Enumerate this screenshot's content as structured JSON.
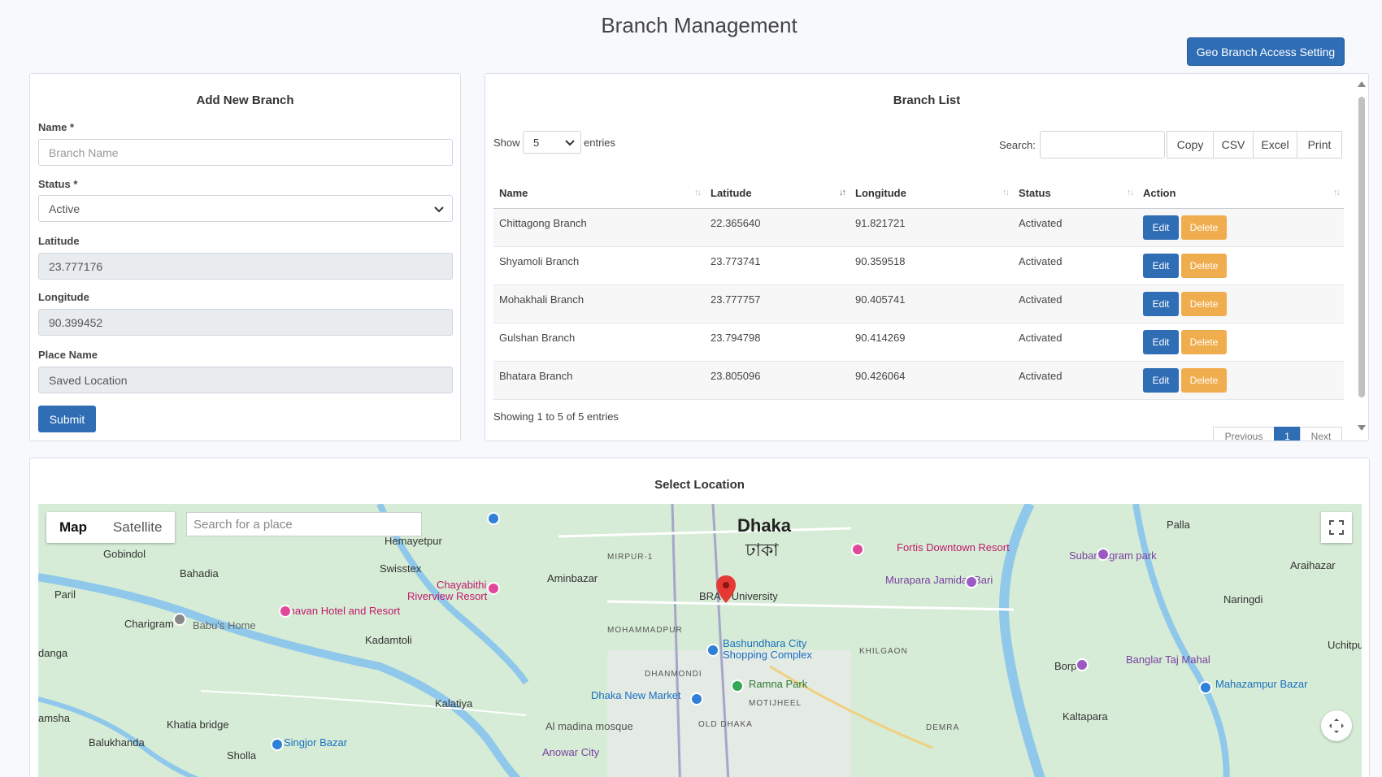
{
  "page_title": "Branch Management",
  "geo_button": "Geo Branch Access Setting",
  "add_form": {
    "title": "Add New Branch",
    "name_label": "Name *",
    "name_placeholder": "Branch Name",
    "status_label": "Status *",
    "status_value": "Active",
    "latitude_label": "Latitude",
    "latitude_value": "23.777176",
    "longitude_label": "Longitude",
    "longitude_value": "90.399452",
    "place_label": "Place Name",
    "place_value": "Saved Location",
    "submit_label": "Submit"
  },
  "branch_list": {
    "title": "Branch List",
    "show_label": "Show",
    "entries_value": "5",
    "entries_label": "entries",
    "search_label": "Search:",
    "export_buttons": [
      "Copy",
      "CSV",
      "Excel",
      "Print"
    ],
    "columns": [
      "Name",
      "Latitude",
      "Longitude",
      "Status",
      "Action"
    ],
    "rows": [
      {
        "name": "Chittagong Branch",
        "lat": "22.365640",
        "lng": "91.821721",
        "status": "Activated"
      },
      {
        "name": "Shyamoli Branch",
        "lat": "23.773741",
        "lng": "90.359518",
        "status": "Activated"
      },
      {
        "name": "Mohakhali Branch",
        "lat": "23.777757",
        "lng": "90.405741",
        "status": "Activated"
      },
      {
        "name": "Gulshan Branch",
        "lat": "23.794798",
        "lng": "90.414269",
        "status": "Activated"
      },
      {
        "name": "Bhatara Branch",
        "lat": "23.805096",
        "lng": "90.426064",
        "status": "Activated"
      }
    ],
    "edit_label": "Edit",
    "delete_label": "Delete",
    "showing_text": "Showing 1 to 5 of 5 entries",
    "pager": {
      "previous": "Previous",
      "current": "1",
      "next": "Next"
    }
  },
  "map": {
    "title": "Select Location",
    "type_map": "Map",
    "type_satellite": "Satellite",
    "search_placeholder": "Search for a place",
    "labels": {
      "dhaka": "Dhaka",
      "dhaka_bn": "ঢাকা",
      "hemayetpur": "Hemayetpur",
      "gobindol": "Gobindol",
      "bahadia": "Bahadia",
      "swisstex": "Swisstex",
      "aminbazar": "Aminbazar",
      "paril": "Paril",
      "chayabithi": "Chayabithi",
      "riverview": "Riverview Resort",
      "shavan": "Shavan Hotel and Resort",
      "charigram": "Charigram",
      "babus_home": "Babu's Home",
      "kadamtoli": "Kadamtoli",
      "danga": "danga",
      "brac": "BRAC University",
      "mohammadpur": "MOHAMMADPUR",
      "bashundhara": "Bashundhara City",
      "shopping": "Shopping Complex",
      "khilgaon": "KHILGAON",
      "fortis": "Fortis Downtown Resort",
      "murapara": "Murapara Jamidar Bari",
      "subarnagram": "Subarnagram park",
      "palla": "Palla",
      "araihazar": "Araihazar",
      "naringdi": "Naringdi",
      "dhanmondi": "DHANMONDI",
      "ramna": "Ramna Park",
      "new_market": "Dhaka New Market",
      "motijheel": "MOTIJHEEL",
      "kalatiya": "Kalatiya",
      "khatia": "Khatia bridge",
      "singjor": "Singjor Bazar",
      "balukhanda": "Balukhanda",
      "amsha": "amsha",
      "al_madina": "Al madina mosque",
      "old_dhaka": "OLD DHAKA",
      "demra": "DEMRA",
      "borpa": "Borpa",
      "banglar_taj": "Banglar Taj Mahal",
      "mahazampur": "Mahazampur Bazar",
      "kaltapara": "Kaltapara",
      "uchitpura": "Uchitpura",
      "mirpur": "MIRPUR-1",
      "anowar": "Anowar City",
      "sholla": "Sholla"
    }
  }
}
